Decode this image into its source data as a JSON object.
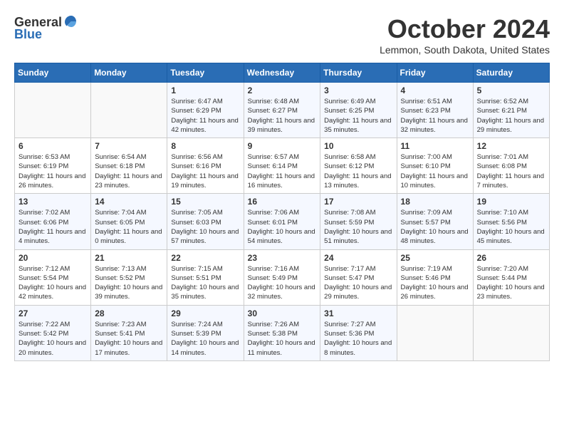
{
  "header": {
    "logo_line1": "General",
    "logo_line2": "Blue",
    "month": "October 2024",
    "location": "Lemmon, South Dakota, United States"
  },
  "days_of_week": [
    "Sunday",
    "Monday",
    "Tuesday",
    "Wednesday",
    "Thursday",
    "Friday",
    "Saturday"
  ],
  "weeks": [
    [
      {
        "day": "",
        "info": ""
      },
      {
        "day": "",
        "info": ""
      },
      {
        "day": "1",
        "info": "Sunrise: 6:47 AM\nSunset: 6:29 PM\nDaylight: 11 hours and 42 minutes."
      },
      {
        "day": "2",
        "info": "Sunrise: 6:48 AM\nSunset: 6:27 PM\nDaylight: 11 hours and 39 minutes."
      },
      {
        "day": "3",
        "info": "Sunrise: 6:49 AM\nSunset: 6:25 PM\nDaylight: 11 hours and 35 minutes."
      },
      {
        "day": "4",
        "info": "Sunrise: 6:51 AM\nSunset: 6:23 PM\nDaylight: 11 hours and 32 minutes."
      },
      {
        "day": "5",
        "info": "Sunrise: 6:52 AM\nSunset: 6:21 PM\nDaylight: 11 hours and 29 minutes."
      }
    ],
    [
      {
        "day": "6",
        "info": "Sunrise: 6:53 AM\nSunset: 6:19 PM\nDaylight: 11 hours and 26 minutes."
      },
      {
        "day": "7",
        "info": "Sunrise: 6:54 AM\nSunset: 6:18 PM\nDaylight: 11 hours and 23 minutes."
      },
      {
        "day": "8",
        "info": "Sunrise: 6:56 AM\nSunset: 6:16 PM\nDaylight: 11 hours and 19 minutes."
      },
      {
        "day": "9",
        "info": "Sunrise: 6:57 AM\nSunset: 6:14 PM\nDaylight: 11 hours and 16 minutes."
      },
      {
        "day": "10",
        "info": "Sunrise: 6:58 AM\nSunset: 6:12 PM\nDaylight: 11 hours and 13 minutes."
      },
      {
        "day": "11",
        "info": "Sunrise: 7:00 AM\nSunset: 6:10 PM\nDaylight: 11 hours and 10 minutes."
      },
      {
        "day": "12",
        "info": "Sunrise: 7:01 AM\nSunset: 6:08 PM\nDaylight: 11 hours and 7 minutes."
      }
    ],
    [
      {
        "day": "13",
        "info": "Sunrise: 7:02 AM\nSunset: 6:06 PM\nDaylight: 11 hours and 4 minutes."
      },
      {
        "day": "14",
        "info": "Sunrise: 7:04 AM\nSunset: 6:05 PM\nDaylight: 11 hours and 0 minutes."
      },
      {
        "day": "15",
        "info": "Sunrise: 7:05 AM\nSunset: 6:03 PM\nDaylight: 10 hours and 57 minutes."
      },
      {
        "day": "16",
        "info": "Sunrise: 7:06 AM\nSunset: 6:01 PM\nDaylight: 10 hours and 54 minutes."
      },
      {
        "day": "17",
        "info": "Sunrise: 7:08 AM\nSunset: 5:59 PM\nDaylight: 10 hours and 51 minutes."
      },
      {
        "day": "18",
        "info": "Sunrise: 7:09 AM\nSunset: 5:57 PM\nDaylight: 10 hours and 48 minutes."
      },
      {
        "day": "19",
        "info": "Sunrise: 7:10 AM\nSunset: 5:56 PM\nDaylight: 10 hours and 45 minutes."
      }
    ],
    [
      {
        "day": "20",
        "info": "Sunrise: 7:12 AM\nSunset: 5:54 PM\nDaylight: 10 hours and 42 minutes."
      },
      {
        "day": "21",
        "info": "Sunrise: 7:13 AM\nSunset: 5:52 PM\nDaylight: 10 hours and 39 minutes."
      },
      {
        "day": "22",
        "info": "Sunrise: 7:15 AM\nSunset: 5:51 PM\nDaylight: 10 hours and 35 minutes."
      },
      {
        "day": "23",
        "info": "Sunrise: 7:16 AM\nSunset: 5:49 PM\nDaylight: 10 hours and 32 minutes."
      },
      {
        "day": "24",
        "info": "Sunrise: 7:17 AM\nSunset: 5:47 PM\nDaylight: 10 hours and 29 minutes."
      },
      {
        "day": "25",
        "info": "Sunrise: 7:19 AM\nSunset: 5:46 PM\nDaylight: 10 hours and 26 minutes."
      },
      {
        "day": "26",
        "info": "Sunrise: 7:20 AM\nSunset: 5:44 PM\nDaylight: 10 hours and 23 minutes."
      }
    ],
    [
      {
        "day": "27",
        "info": "Sunrise: 7:22 AM\nSunset: 5:42 PM\nDaylight: 10 hours and 20 minutes."
      },
      {
        "day": "28",
        "info": "Sunrise: 7:23 AM\nSunset: 5:41 PM\nDaylight: 10 hours and 17 minutes."
      },
      {
        "day": "29",
        "info": "Sunrise: 7:24 AM\nSunset: 5:39 PM\nDaylight: 10 hours and 14 minutes."
      },
      {
        "day": "30",
        "info": "Sunrise: 7:26 AM\nSunset: 5:38 PM\nDaylight: 10 hours and 11 minutes."
      },
      {
        "day": "31",
        "info": "Sunrise: 7:27 AM\nSunset: 5:36 PM\nDaylight: 10 hours and 8 minutes."
      },
      {
        "day": "",
        "info": ""
      },
      {
        "day": "",
        "info": ""
      }
    ]
  ]
}
